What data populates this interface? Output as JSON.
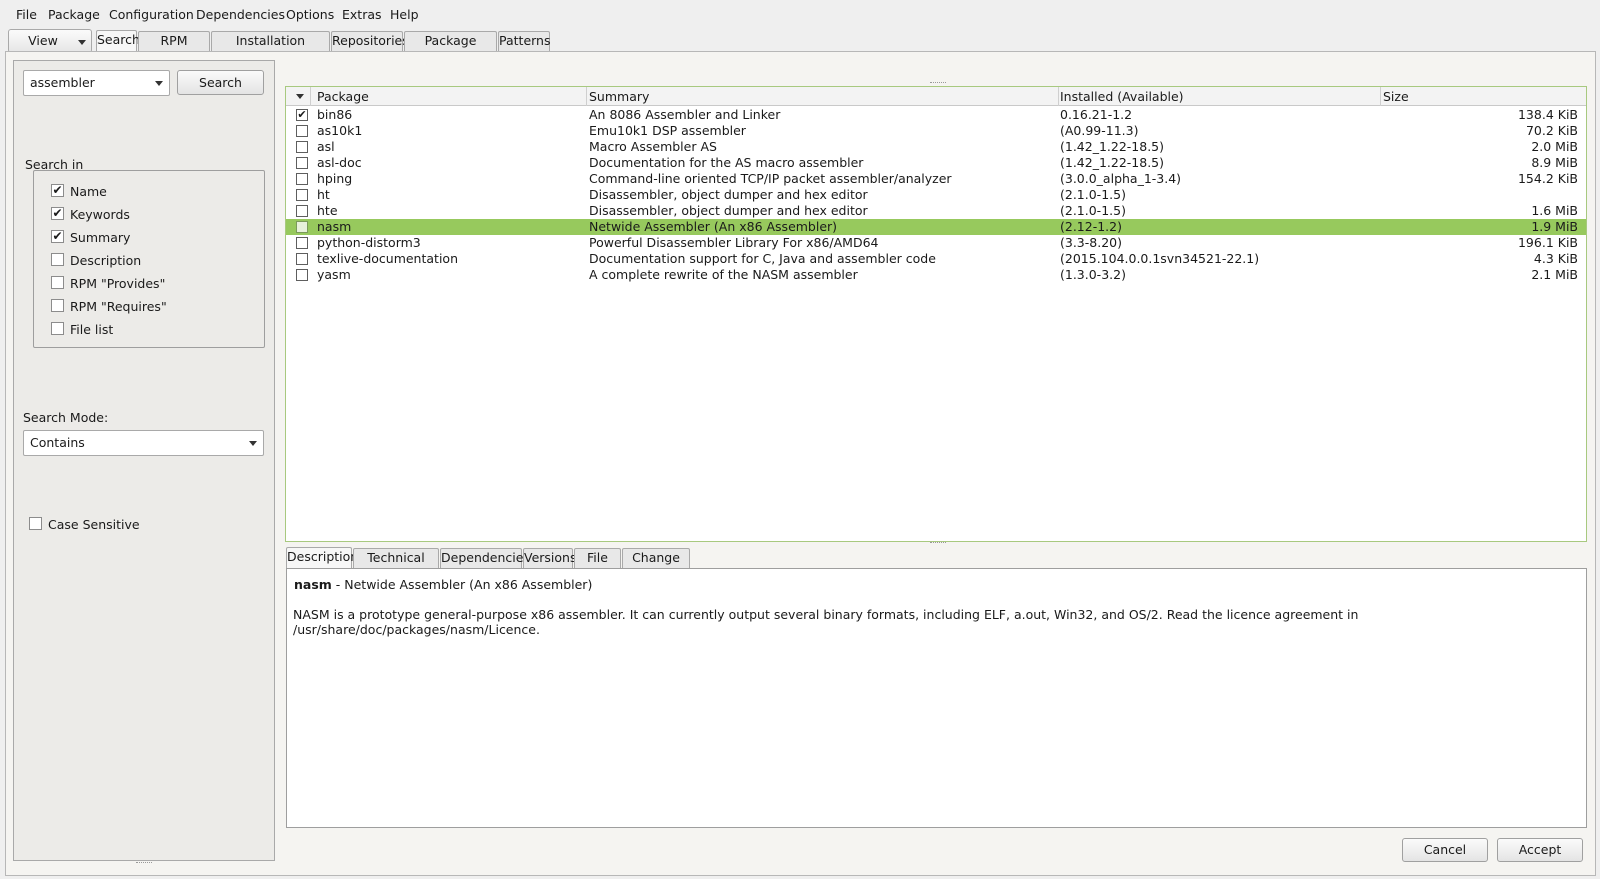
{
  "menu": [
    "File",
    "Package",
    "Configuration",
    "Dependencies",
    "Options",
    "Extras",
    "Help"
  ],
  "view_button": "View",
  "top_tabs": [
    "Search",
    "RPM Groups",
    "Installation Summary",
    "Repositories",
    "Package Groups",
    "Patterns"
  ],
  "search": {
    "query": "assembler",
    "button": "Search",
    "search_in_label": "Search in",
    "options": [
      {
        "label": "Name",
        "checked": true
      },
      {
        "label": "Keywords",
        "checked": true
      },
      {
        "label": "Summary",
        "checked": true
      },
      {
        "label": "Description",
        "checked": false
      },
      {
        "label": "RPM \"Provides\"",
        "checked": false
      },
      {
        "label": "RPM \"Requires\"",
        "checked": false
      },
      {
        "label": "File list",
        "checked": false
      }
    ],
    "mode_label": "Search Mode:",
    "mode_value": "Contains",
    "case_sensitive_label": "Case Sensitive"
  },
  "table": {
    "headers": [
      "Package",
      "Summary",
      "Installed (Available)",
      "Size"
    ],
    "rows": [
      {
        "name": "bin86",
        "summary": "An 8086 Assembler and Linker",
        "version": "0.16.21-1.2",
        "size": "138.4 KiB",
        "installed": true
      },
      {
        "name": "as10k1",
        "summary": "Emu10k1 DSP assembler",
        "version": "(A0.99-11.3)",
        "size": "70.2 KiB"
      },
      {
        "name": "asl",
        "summary": "Macro Assembler AS",
        "version": "(1.42_1.22-18.5)",
        "size": "2.0 MiB"
      },
      {
        "name": "asl-doc",
        "summary": "Documentation for the AS macro assembler",
        "version": "(1.42_1.22-18.5)",
        "size": "8.9 MiB"
      },
      {
        "name": "hping",
        "summary": "Command-line oriented TCP/IP packet assembler/analyzer",
        "version": "(3.0.0_alpha_1-3.4)",
        "size": "154.2 KiB"
      },
      {
        "name": "ht",
        "summary": "Disassembler, object dumper and hex editor",
        "version": "(2.1.0-1.5)",
        "size": ""
      },
      {
        "name": "hte",
        "summary": "Disassembler, object dumper and hex editor",
        "version": "(2.1.0-1.5)",
        "size": "1.6 MiB"
      },
      {
        "name": "nasm",
        "summary": "Netwide Assembler (An x86 Assembler)",
        "version": "(2.12-1.2)",
        "size": "1.9 MiB",
        "selected": true
      },
      {
        "name": "python-distorm3",
        "summary": "Powerful Disassembler Library For x86/AMD64",
        "version": "(3.3-8.20)",
        "size": "196.1 KiB"
      },
      {
        "name": "texlive-documentation",
        "summary": "Documentation support for C, Java and assembler code",
        "version": "(2015.104.0.0.1svn34521-22.1)",
        "size": "4.3 KiB"
      },
      {
        "name": "yasm",
        "summary": "A complete rewrite of the NASM assembler",
        "version": "(1.3.0-3.2)",
        "size": "2.1 MiB"
      }
    ]
  },
  "detail_tabs": [
    "Description",
    "Technical Data",
    "Dependencies",
    "Versions",
    "File List",
    "Change Log"
  ],
  "detail": {
    "name": "nasm",
    "summary": " - Netwide Assembler (An x86 Assembler)",
    "description": "NASM is a prototype general-purpose x86 assembler. It can currently output several binary formats, including ELF, a.out, Win32, and OS/2. Read the licence agreement in /usr/share/doc/packages/nasm/Licence."
  },
  "buttons": {
    "cancel": "Cancel",
    "accept": "Accept"
  }
}
